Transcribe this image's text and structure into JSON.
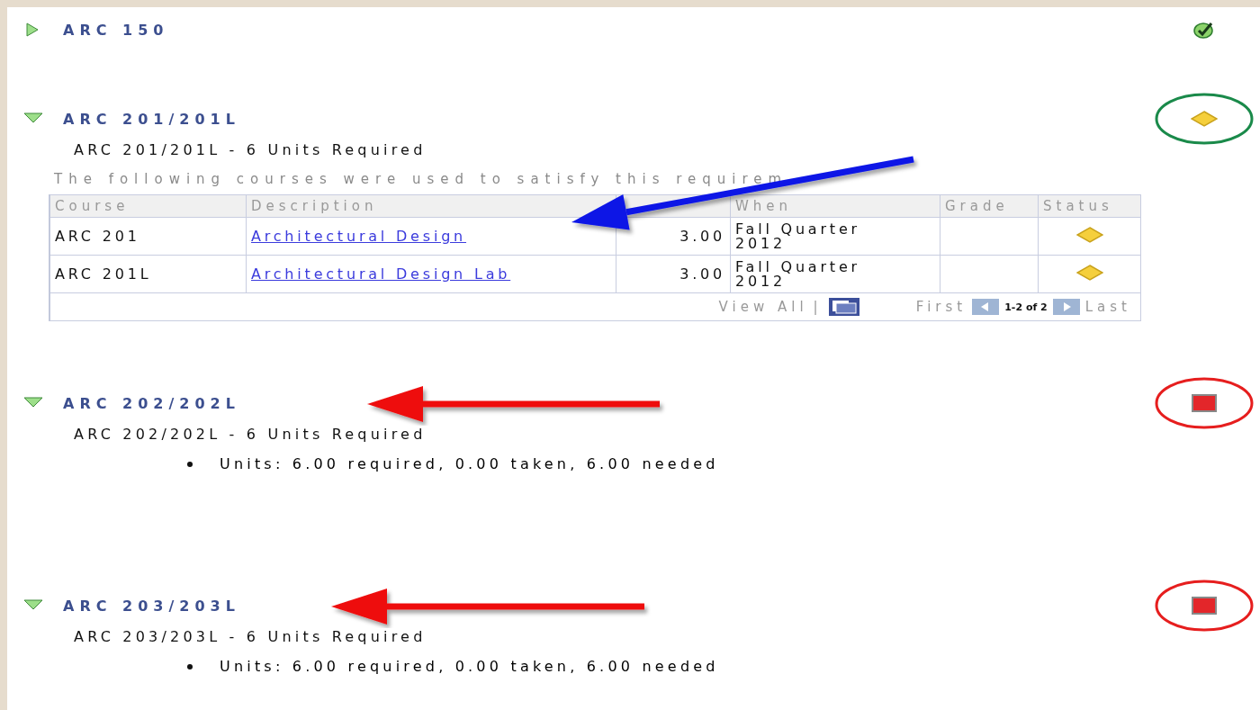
{
  "requirements": [
    {
      "title": "ARC 150",
      "expanded": false,
      "status": {
        "kind": "complete"
      }
    },
    {
      "title": "ARC 201/201L",
      "expanded": true,
      "status": {
        "kind": "in_progress"
      },
      "highlight": {
        "color": "#1a8a4a"
      },
      "subtitle": "ARC 201/201L - 6 Units Required",
      "description": "The following courses were used to satisfy this requirem",
      "table": {
        "columns": [
          "Course",
          "Description",
          "",
          "When",
          "Grade",
          "Status"
        ],
        "rows": [
          {
            "course": "ARC 201",
            "description": "Architectural Design",
            "units": "3.00",
            "when": "Fall Quarter 2012",
            "status": {
              "kind": "in_progress"
            }
          },
          {
            "course": "ARC 201L",
            "description": "Architectural Design Lab",
            "units": "3.00",
            "when": "Fall Quarter 2012",
            "status": {
              "kind": "in_progress"
            }
          }
        ],
        "footer": {
          "view_all": "View All",
          "separator": "|",
          "first": "First",
          "range": "1-2 of 2",
          "last": "Last"
        },
        "arrow": {
          "color": "#0a14e6"
        }
      }
    },
    {
      "title": "ARC 202/202L",
      "expanded": true,
      "status": {
        "kind": "not_satisfied"
      },
      "highlight": {
        "color": "#e61e1e"
      },
      "arrow": {
        "color": "#ee1111"
      },
      "subtitle": "ARC 202/202L - 6 Units Required",
      "bullets": [
        "Units: 6.00 required, 0.00 taken, 6.00 needed"
      ]
    },
    {
      "title": "ARC 203/203L",
      "expanded": true,
      "status": {
        "kind": "not_satisfied"
      },
      "highlight": {
        "color": "#e61e1e"
      },
      "arrow": {
        "color": "#ee1111"
      },
      "subtitle": "ARC 203/203L - 6 Units Required",
      "bullets": [
        "Units: 6.00 required, 0.00 taken, 6.00 needed"
      ]
    }
  ]
}
